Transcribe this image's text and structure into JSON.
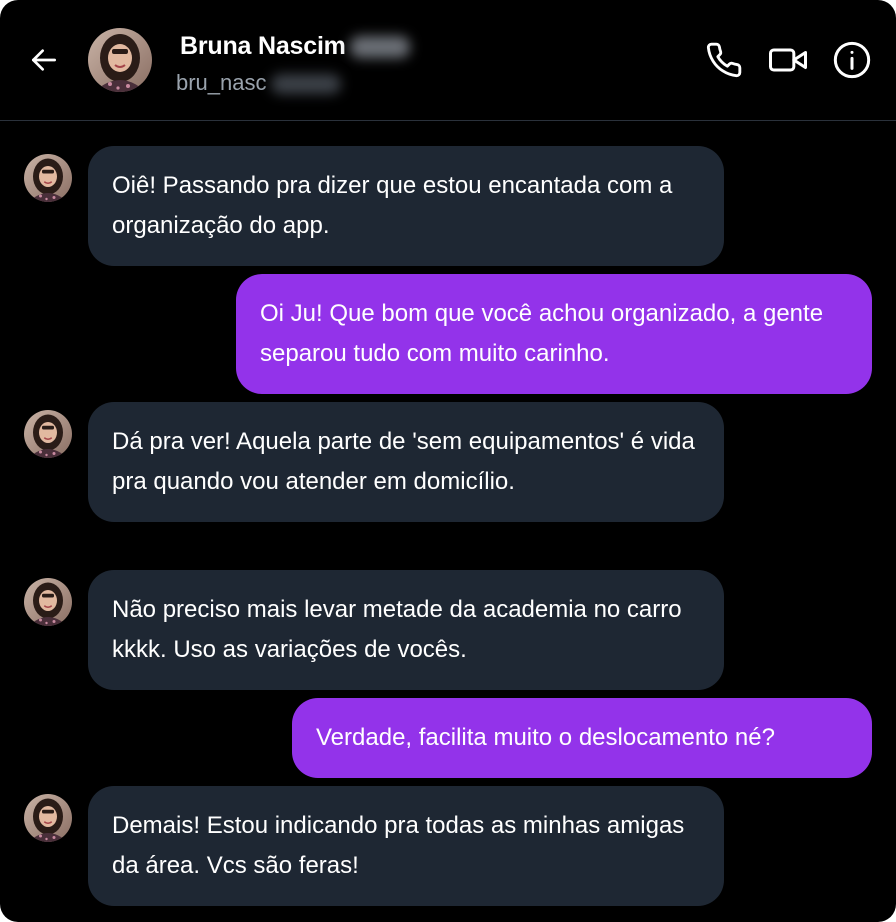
{
  "header": {
    "contact_name": "Bruna Nascim",
    "contact_handle": "bru_nasc"
  },
  "icons": {
    "back": "arrow-left-icon",
    "call": "phone-icon",
    "video": "video-camera-icon",
    "info": "info-icon"
  },
  "colors": {
    "background": "#000000",
    "incoming_bubble": "#1e2733",
    "outgoing_bubble": "#9333ea",
    "text": "#ffffff",
    "muted_text": "#9aa3ad"
  },
  "messages": [
    {
      "direction": "incoming",
      "text": "Oiê! Passando pra dizer que estou encantada com a organização do app."
    },
    {
      "direction": "outgoing",
      "text": "Oi Ju! Que bom que você achou organizado, a gente separou tudo com muito carinho."
    },
    {
      "direction": "incoming",
      "text": "Dá pra ver! Aquela parte de 'sem equipamentos' é vida pra quando vou atender em domicílio."
    },
    {
      "direction": "incoming",
      "text": "Não preciso mais levar metade da academia no carro kkkk. Uso as variações de vocês."
    },
    {
      "direction": "outgoing",
      "text": "Verdade, facilita muito o deslocamento né?"
    },
    {
      "direction": "incoming",
      "text": "Demais! Estou indicando pra todas as minhas amigas da área. Vcs são feras!"
    }
  ]
}
